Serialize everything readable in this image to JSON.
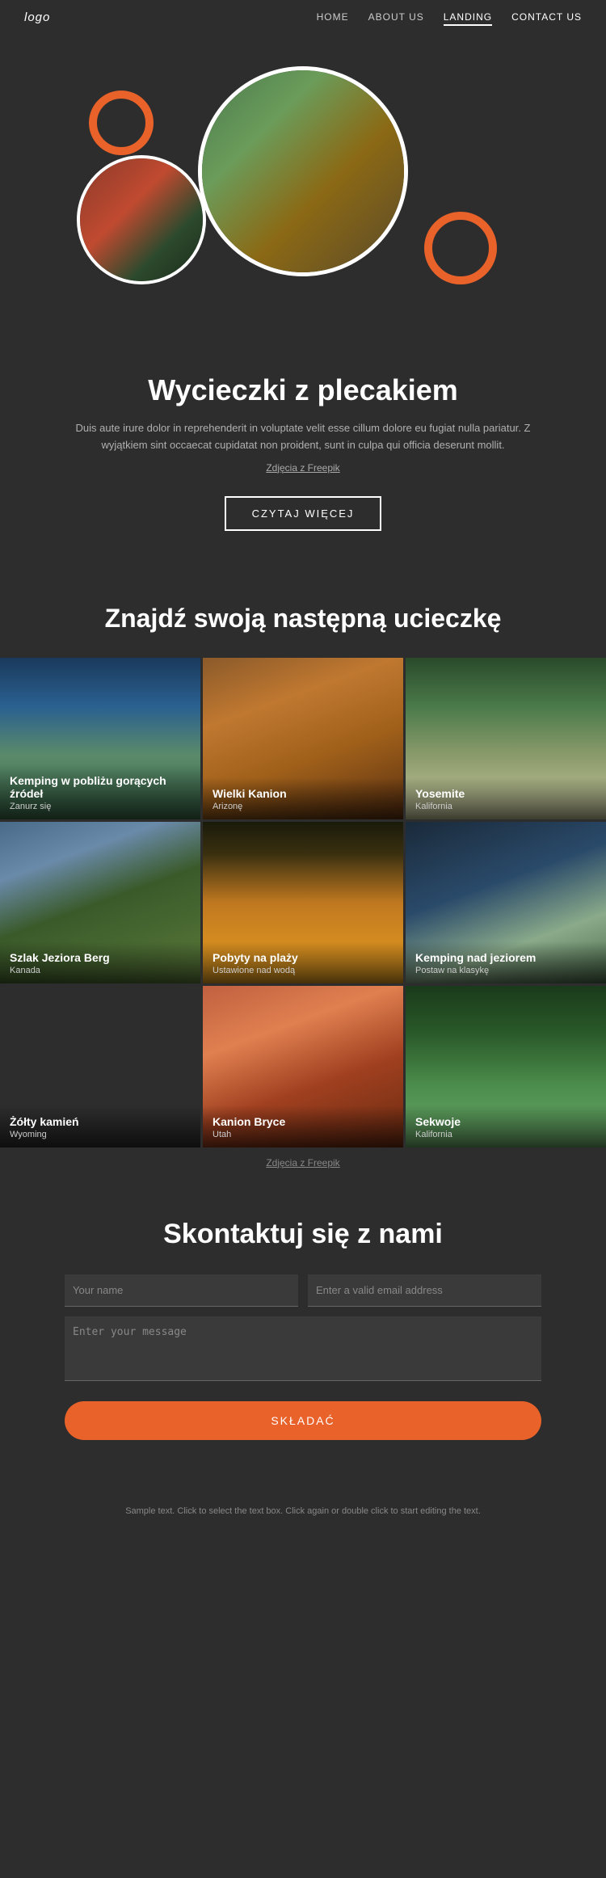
{
  "nav": {
    "logo": "logo",
    "links": [
      {
        "label": "HOME",
        "active": false
      },
      {
        "label": "ABOUT US",
        "active": false
      },
      {
        "label": "LANDING",
        "active": true
      },
      {
        "label": "CONTACT US",
        "active": false
      }
    ]
  },
  "hero": {
    "title": "Wycieczki z plecakiem",
    "description": "Duis aute irure dolor in reprehenderit in voluptate velit esse cillum dolore eu fugiat nulla pariatur. Z wyjątkiem sint occaecat cupidatat non proident, sunt in culpa qui officia deserunt mollit.",
    "freepik_label": "Zdjęcia z Freepik",
    "read_more_btn": "CZYTAJ WIĘCEJ"
  },
  "find_section": {
    "title": "Znajdź swoją następną ucieczkę"
  },
  "grid": {
    "items": [
      {
        "title": "Kemping w pobliżu gorących źródeł",
        "sub": "Zanurz się",
        "bg": "waterfall"
      },
      {
        "title": "Wielki Kanion",
        "sub": "Arizonę",
        "bg": "canyon"
      },
      {
        "title": "Yosemite",
        "sub": "Kalifornia",
        "bg": "yosemite"
      },
      {
        "title": "Szlak Jeziora Berg",
        "sub": "Kanada",
        "bg": "berg"
      },
      {
        "title": "Pobyty na plaży",
        "sub": "Ustawione nad wodą",
        "bg": "beach"
      },
      {
        "title": "Kemping nad jeziorem",
        "sub": "Postaw na klasykę",
        "bg": "lake"
      },
      {
        "title": "Żółty kamień",
        "sub": "Wyoming",
        "bg": "yellow"
      },
      {
        "title": "Kanion Bryce",
        "sub": "Utah",
        "bg": "bryce"
      },
      {
        "title": "Sekwoje",
        "sub": "Kalifornia",
        "bg": "sequoia"
      }
    ],
    "freepik_label": "Zdjęcia z Freepik"
  },
  "contact": {
    "title": "Skontaktuj się z nami",
    "name_placeholder": "Your name",
    "email_placeholder": "Enter a valid email address",
    "message_placeholder": "Enter your message",
    "submit_btn": "SKŁADAĆ"
  },
  "footer": {
    "text": "Sample text. Click to select the text box. Click again or double click to start editing the text."
  }
}
